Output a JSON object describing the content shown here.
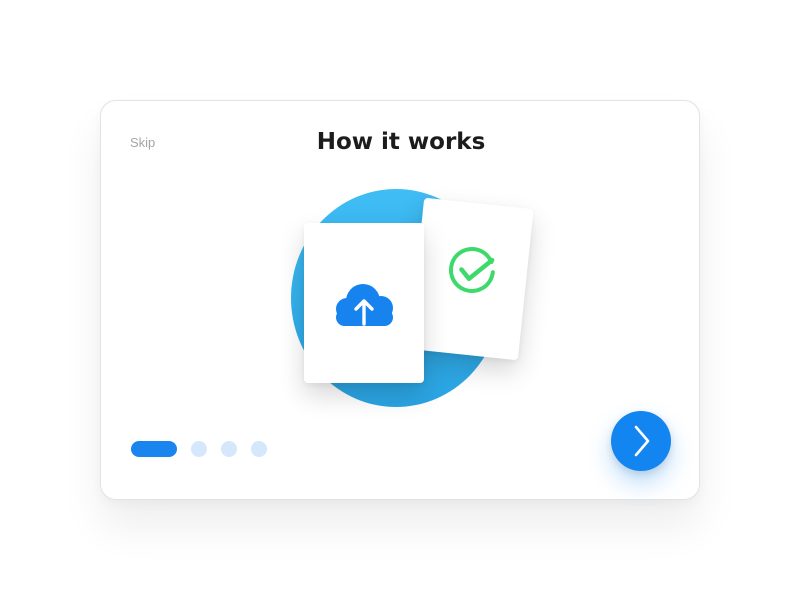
{
  "onboarding": {
    "skip_label": "Skip",
    "title": "How it works",
    "pagination": {
      "total_steps": 4,
      "current_step": 1
    },
    "next_icon": "chevron-right-icon",
    "illustration": {
      "upload_icon": "cloud-upload-icon",
      "success_icon": "check-circle-icon"
    }
  },
  "colors": {
    "accent": "#1385f0",
    "circle": "#34b1ec",
    "success": "#3ed96b",
    "inactive_dot": "#d4e7fb",
    "title": "#1c1c1c",
    "skip": "#a5a5a5"
  }
}
